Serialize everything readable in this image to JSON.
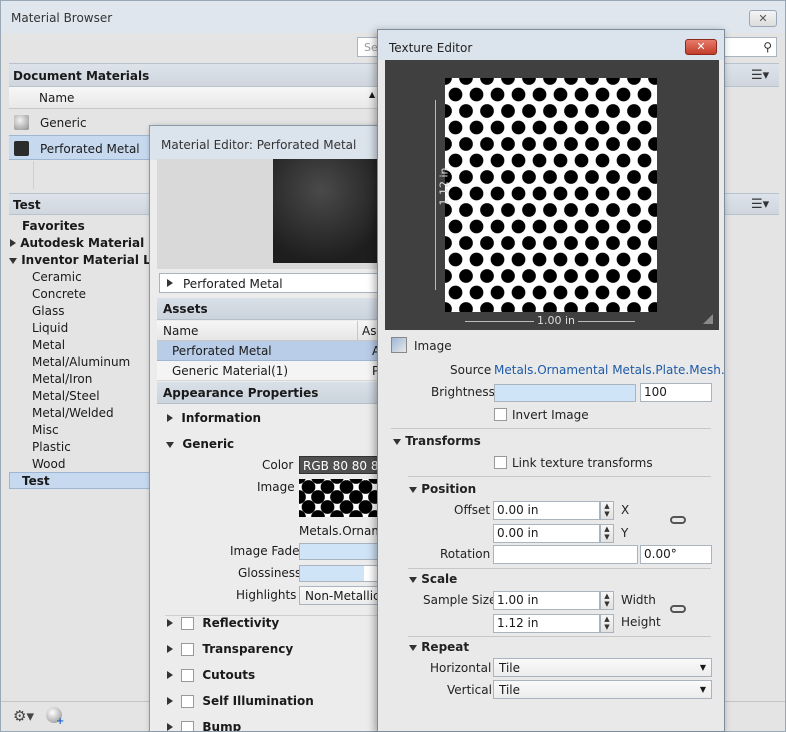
{
  "material_browser": {
    "title": "Material Browser",
    "close": "✕",
    "search_placeholder": "Sea",
    "document_materials_header": "Document Materials",
    "name_column": "Name",
    "materials": [
      {
        "name": "Generic",
        "swatch": "#bdbdbd"
      },
      {
        "name": "Perforated Metal",
        "swatch": "#2b2b2b"
      }
    ],
    "test_header": "Test",
    "tree": [
      {
        "label": "Favorites",
        "bold": true
      },
      {
        "label": "Autodesk Material Libra",
        "bold": true,
        "arrow": "right"
      },
      {
        "label": "Inventor Material Libra",
        "bold": true,
        "arrow": "down"
      },
      {
        "label": "Ceramic"
      },
      {
        "label": "Concrete"
      },
      {
        "label": "Glass"
      },
      {
        "label": "Liquid"
      },
      {
        "label": "Metal"
      },
      {
        "label": "Metal/Aluminum"
      },
      {
        "label": "Metal/Iron"
      },
      {
        "label": "Metal/Steel"
      },
      {
        "label": "Metal/Welded"
      },
      {
        "label": "Misc"
      },
      {
        "label": "Plastic"
      },
      {
        "label": "Wood"
      },
      {
        "label": "Test",
        "bold": true,
        "selected": true
      }
    ]
  },
  "material_editor": {
    "title": "Material Editor: Perforated Metal",
    "material_name": "Perforated Metal",
    "assets_header": "Assets",
    "col_name": "Name",
    "col_asset": "As",
    "assets": [
      {
        "name": "Perforated Metal",
        "col2": "A"
      },
      {
        "name": "Generic Material(1)",
        "col2": "P"
      }
    ],
    "appearance_header": "Appearance Properties",
    "information": "Information",
    "generic": "Generic",
    "color_label": "Color",
    "color_value": "RGB 80 80 80",
    "image_label": "Image",
    "image_name": "Metals.Ornamen",
    "image_fade_label": "Image Fade",
    "glossiness_label": "Glossiness",
    "highlights_label": "Highlights",
    "highlights_value": "Non-Metallic",
    "sections": [
      "Reflectivity",
      "Transparency",
      "Cutouts",
      "Self Illumination",
      "Bump"
    ],
    "image_fade_level": 1.0,
    "glossiness_level": 0.73
  },
  "texture_editor": {
    "title": "Texture Editor",
    "close": "✕",
    "dim_vertical": "1.12 in",
    "dim_horizontal": "1.00 in",
    "image_section": "Image",
    "source_label": "Source",
    "source_value": "Metals.Ornamental Metals.Plate.Mesh.cut",
    "brightness_label": "Brightness",
    "brightness_value": "100",
    "brightness_level": 1.0,
    "invert_label": "Invert Image",
    "transforms_header": "Transforms",
    "link_label": "Link texture transforms",
    "position_header": "Position",
    "offset_label": "Offset",
    "offset_x": "0.00 in",
    "offset_y": "0.00 in",
    "x_label": "X",
    "y_label": "Y",
    "rotation_label": "Rotation",
    "rotation_value": "0.00°",
    "scale_header": "Scale",
    "sample_size_label": "Sample Size",
    "width_value": "1.00 in",
    "height_value": "1.12 in",
    "width_label": "Width",
    "height_label": "Height",
    "repeat_header": "Repeat",
    "horizontal_label": "Horizontal",
    "horizontal_value": "Tile",
    "vertical_label": "Vertical",
    "vertical_value": "Tile"
  }
}
